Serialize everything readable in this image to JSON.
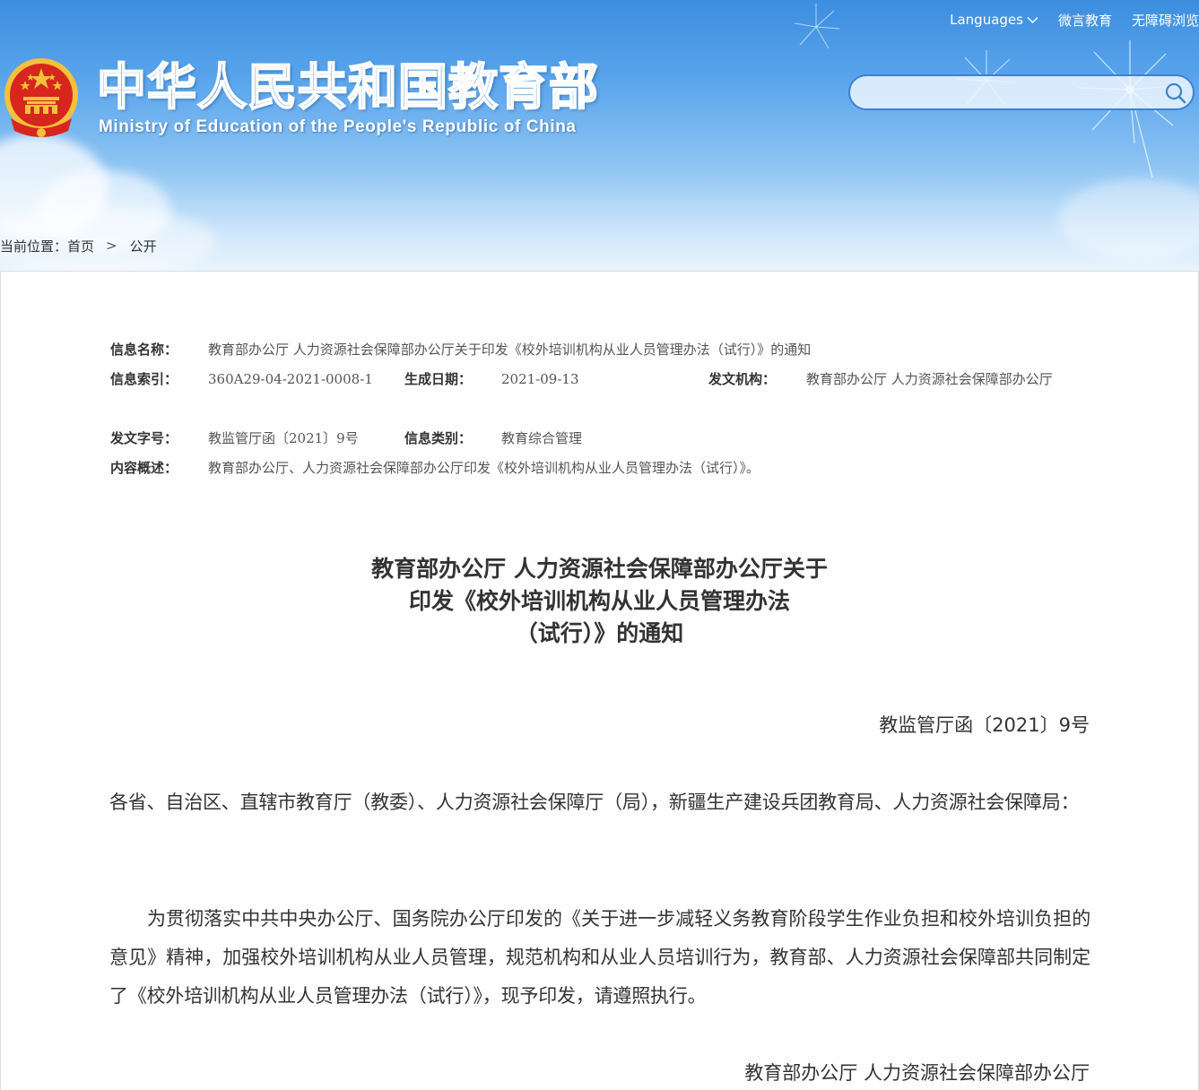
{
  "header": {
    "site_title": "中华人民共和国教育部",
    "site_subtitle": "Ministry of Education of the People's Republic of China",
    "top_links": [
      {
        "label": "Languages",
        "icon": "chevron-down-icon"
      },
      {
        "label": "微言教育"
      },
      {
        "label": "无障碍浏览"
      }
    ],
    "search": {
      "placeholder": "",
      "icon": "search-icon"
    },
    "colors": {
      "sky": "#4f9be6",
      "accent": "#3e82cf",
      "emblem_red": "#d7261e",
      "emblem_gold": "#f3c13a"
    }
  },
  "breadcrumb": {
    "prefix": "当前位置：",
    "items": [
      "首页",
      "公开"
    ],
    "separator": ">"
  },
  "meta": {
    "info_name_label": "信息名称：",
    "info_name_value": "教育部办公厅 人力资源社会保障部办公厅关于印发《校外培训机构从业人员管理办法（试行）》的通知",
    "index_label": "信息索引：",
    "index_value": "360A29-04-2021-0008-1",
    "date_label": "生成日期：",
    "date_value": "2021-09-13",
    "issuer_label": "发文机构：",
    "issuer_value": "教育部办公厅 人力资源社会保障部办公厅",
    "doc_no_label": "发文字号：",
    "doc_no_value": "教监管厅函〔2021〕9号",
    "category_label": "信息类别：",
    "category_value": "教育综合管理",
    "summary_label": "内容概述：",
    "summary_value": "教育部办公厅、人力资源社会保障部办公厅印发《校外培训机构从业人员管理办法（试行）》。"
  },
  "article": {
    "title_lines": [
      "教育部办公厅 人力资源社会保障部办公厅关于",
      "印发《校外培训机构从业人员管理办法",
      "（试行）》的通知"
    ],
    "doc_number": "教监管厅函〔2021〕9号",
    "addressee": "各省、自治区、直辖市教育厅（教委）、人力资源社会保障厅（局），新疆生产建设兵团教育局、人力资源社会保障局：",
    "body": "为贯彻落实中共中央办公厅、国务院办公厅印发的《关于进一步减轻义务教育阶段学生作业负担和校外培训负担的意见》精神，加强校外培训机构从业人员管理，规范机构和从业人员培训行为，教育部、人力资源社会保障部共同制定了《校外培训机构从业人员管理办法（试行）》，现予印发，请遵照执行。",
    "signature": "教育部办公厅 人力资源社会保障部办公厅"
  }
}
